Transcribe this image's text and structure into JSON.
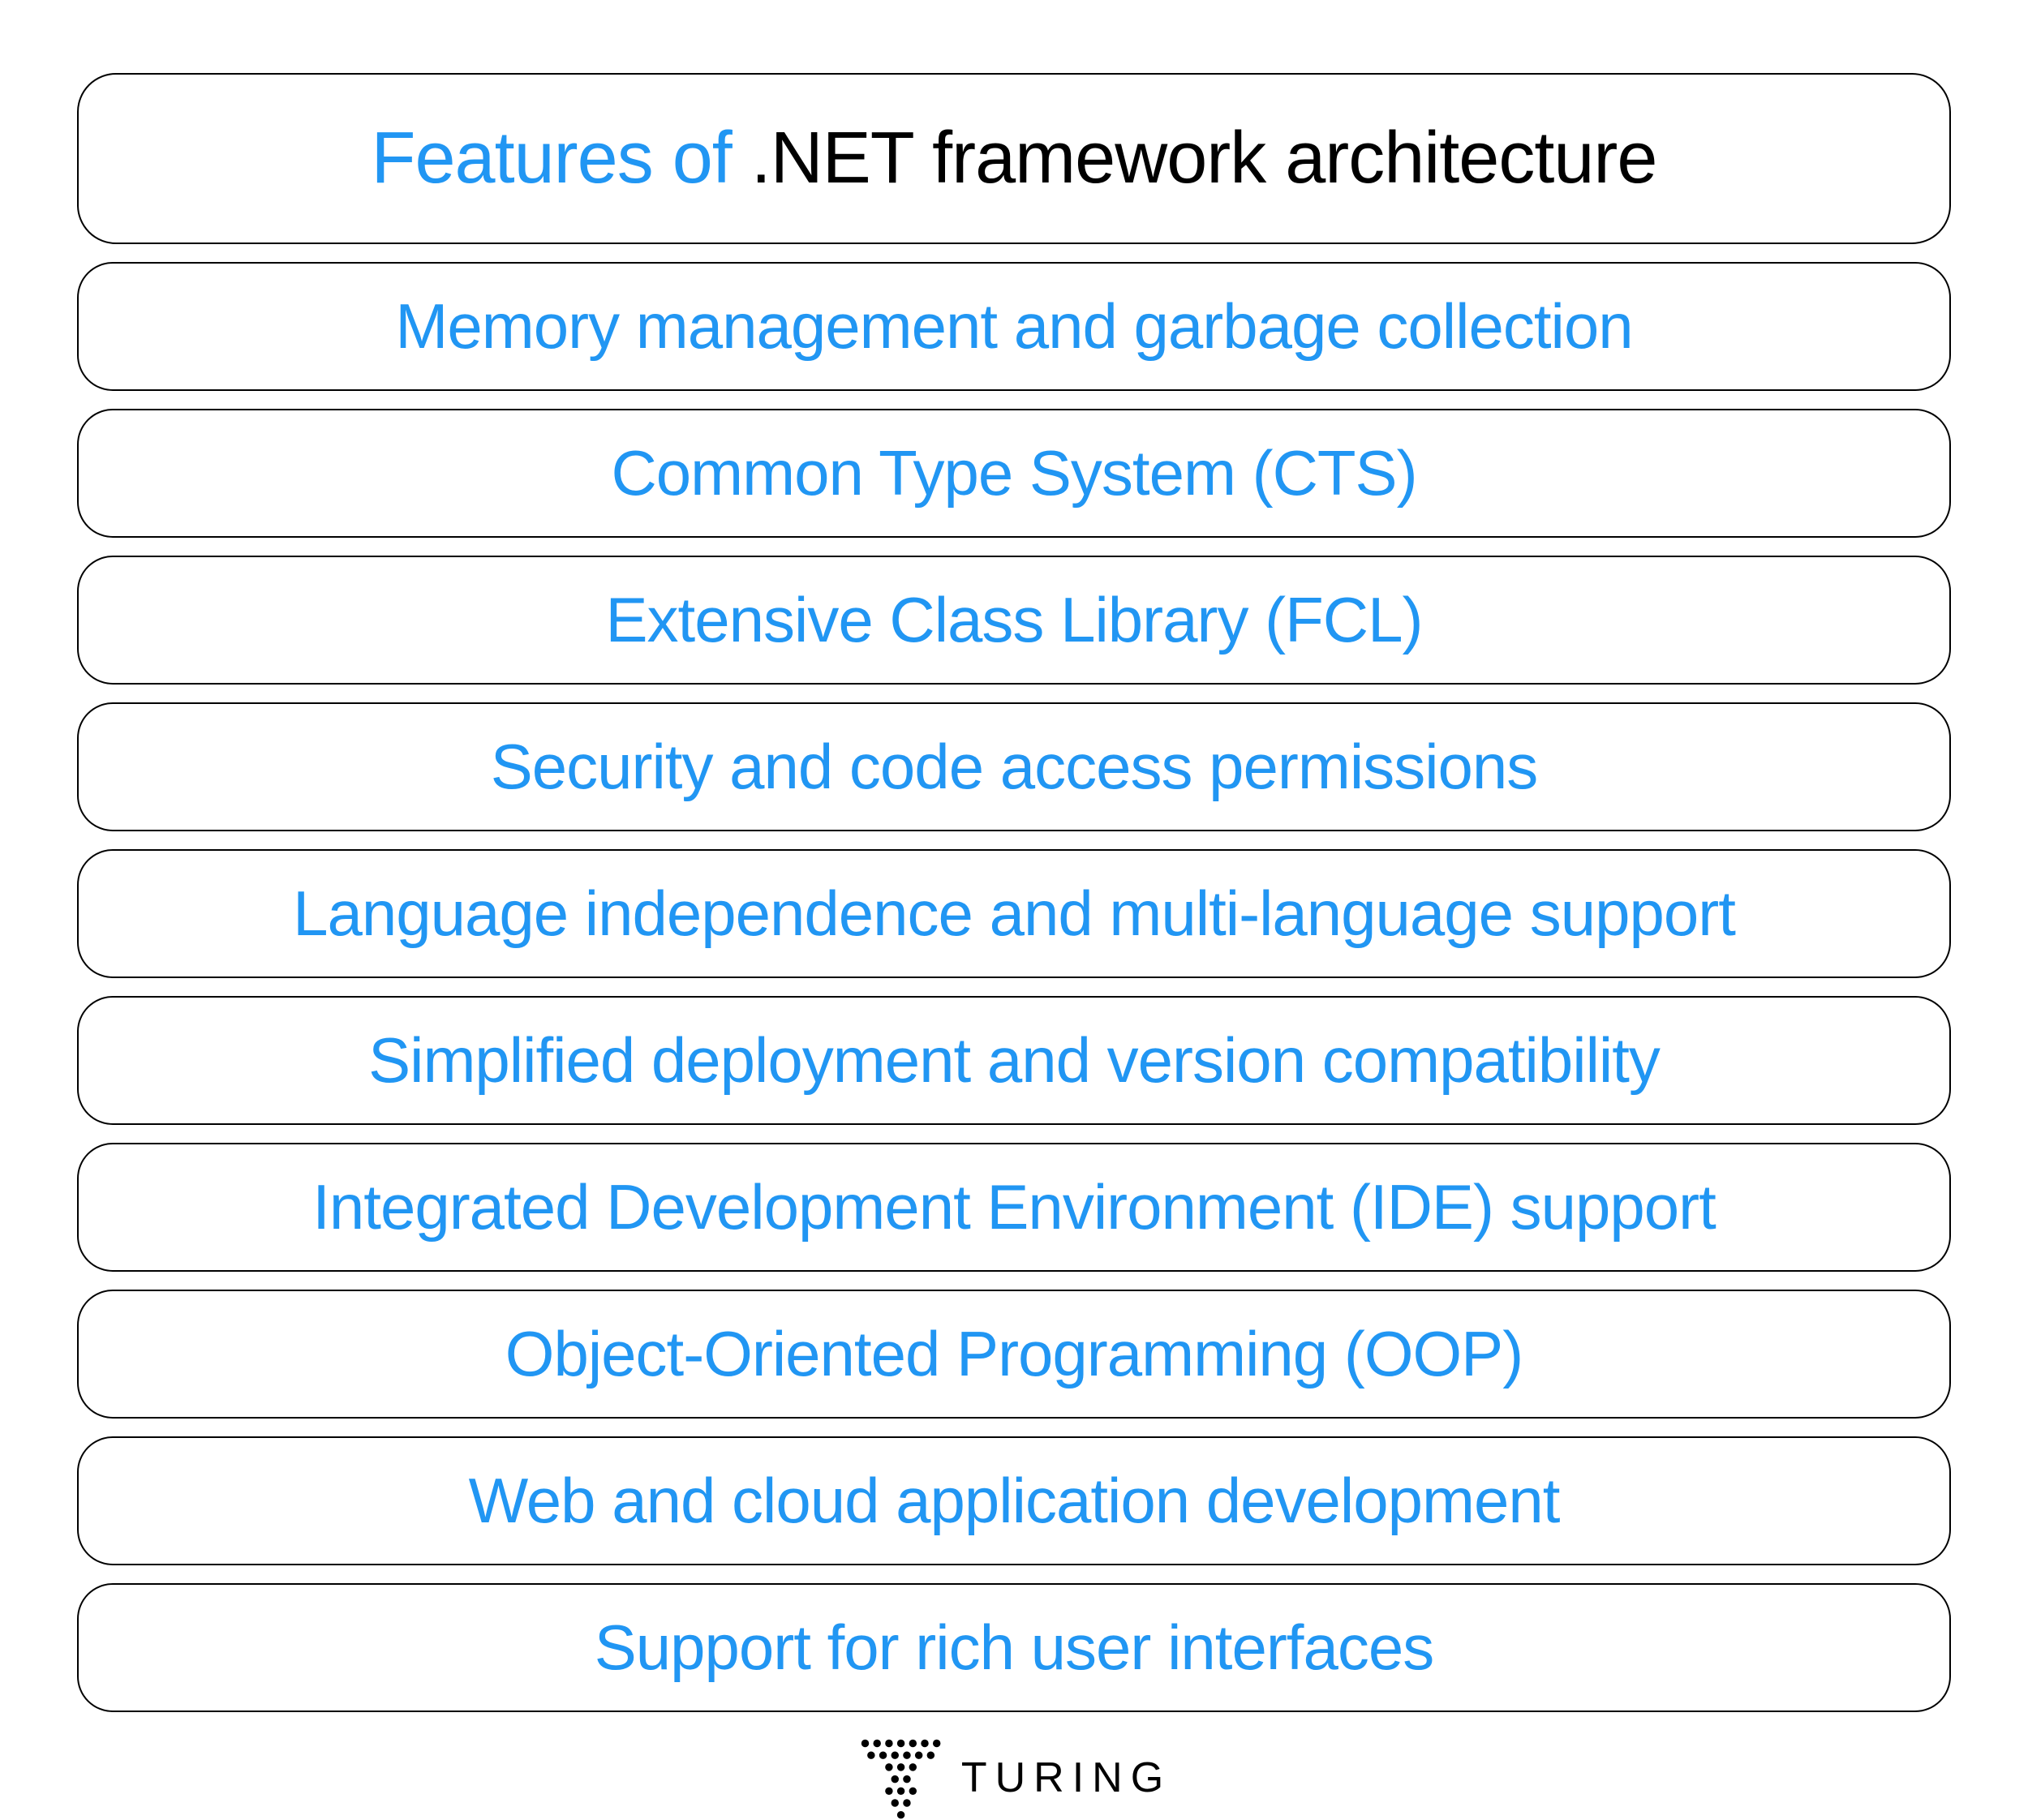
{
  "title": {
    "accent": "Features of",
    "rest": " .NET framework architecture"
  },
  "features": [
    "Memory management and garbage collection",
    "Common Type System (CTS)",
    "Extensive Class Library (FCL)",
    "Security and code access permissions",
    "Language independence and multi-language support",
    "Simplified deployment and version compatibility",
    "Integrated Development Environment (IDE) support",
    "Object-Oriented Programming (OOP)",
    "Web and cloud application development",
    "Support for rich user interfaces"
  ],
  "footer": {
    "brand": "TURING"
  }
}
